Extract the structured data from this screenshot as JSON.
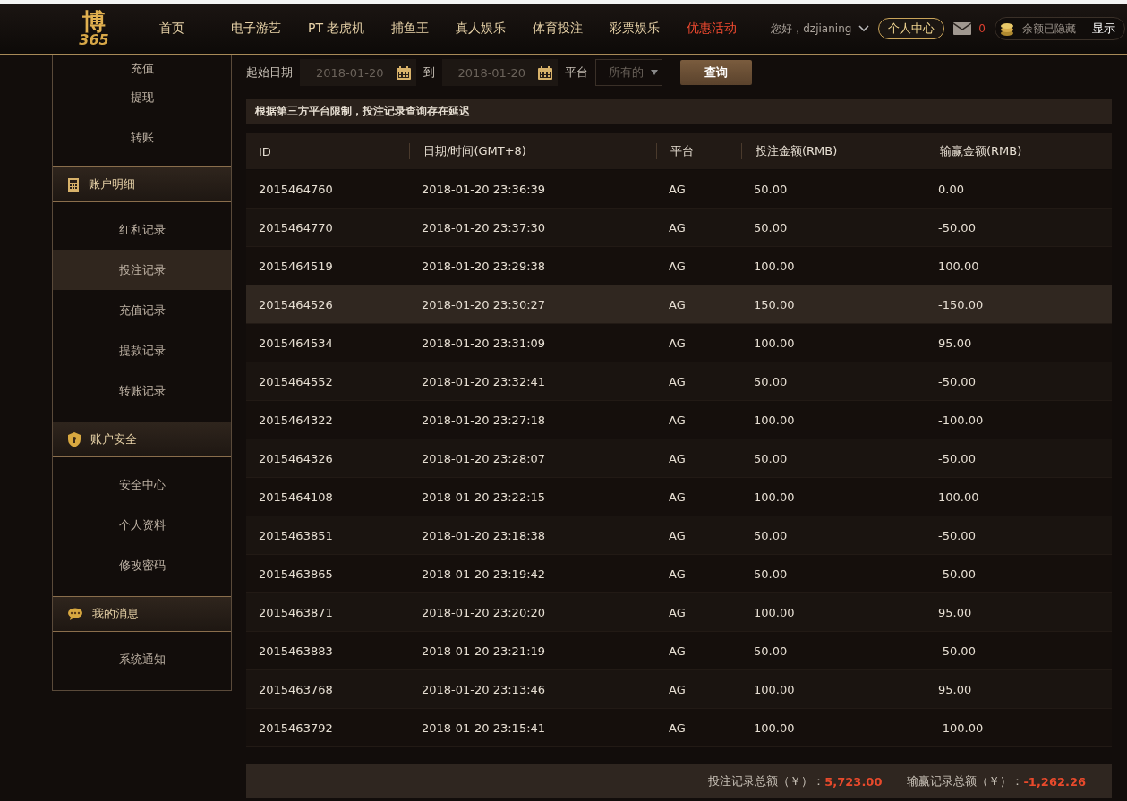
{
  "header": {
    "logo": {
      "text": "博",
      "number": "365"
    },
    "nav": [
      {
        "label": "首页",
        "highlight": false
      },
      {
        "label": "电子游艺",
        "highlight": false
      },
      {
        "label": "PT 老虎机",
        "highlight": false
      },
      {
        "label": "捕鱼王",
        "highlight": false
      },
      {
        "label": "真人娱乐",
        "highlight": false
      },
      {
        "label": "体育投注",
        "highlight": false
      },
      {
        "label": "彩票娱乐",
        "highlight": false
      },
      {
        "label": "优惠活动",
        "highlight": true
      }
    ],
    "greeting": "您好，dzjianing",
    "personal_center": "个人中心",
    "messages_count": "0",
    "balance": "余额已隐藏",
    "show_button": "显示"
  },
  "sidebar": {
    "sections": [
      {
        "items": [
          {
            "label": "充值",
            "selected": false
          },
          {
            "label": "提现",
            "selected": false
          },
          {
            "label": "转账",
            "selected": false
          }
        ]
      },
      {
        "title": "账户明细",
        "kind": "calculator",
        "items": [
          {
            "label": "红利记录",
            "selected": false
          },
          {
            "label": "投注记录",
            "selected": true
          },
          {
            "label": "充值记录",
            "selected": false
          },
          {
            "label": "提款记录",
            "selected": false
          },
          {
            "label": "转账记录",
            "selected": false
          }
        ]
      },
      {
        "title": "账户安全",
        "kind": "shield",
        "items": [
          {
            "label": "安全中心",
            "selected": false
          },
          {
            "label": "个人资料",
            "selected": false
          },
          {
            "label": "修改密码",
            "selected": false
          }
        ]
      },
      {
        "title": "我的消息",
        "kind": "chat",
        "items": [
          {
            "label": "系统通知",
            "selected": false
          }
        ]
      }
    ]
  },
  "filters": {
    "start_label": "起始日期",
    "start_date": "2018-01-20",
    "to_label": "到",
    "end_date": "2018-01-20",
    "platform_label": "平台",
    "platform_value": "所有的",
    "query_button": "查询"
  },
  "notice": "根据第三方平台限制，投注记录查询存在延迟",
  "table": {
    "columns": [
      "ID",
      "日期/时间(GMT+8)",
      "平台",
      "投注金额(RMB)",
      "输赢金额(RMB)"
    ],
    "rows": [
      {
        "cells": [
          "2015464760",
          "2018-01-20 23:36:39",
          "AG",
          "50.00",
          "0.00"
        ],
        "highlighted": false
      },
      {
        "cells": [
          "2015464770",
          "2018-01-20 23:37:30",
          "AG",
          "50.00",
          "-50.00"
        ],
        "highlighted": false
      },
      {
        "cells": [
          "2015464519",
          "2018-01-20 23:29:38",
          "AG",
          "100.00",
          "100.00"
        ],
        "highlighted": false
      },
      {
        "cells": [
          "2015464526",
          "2018-01-20 23:30:27",
          "AG",
          "150.00",
          "-150.00"
        ],
        "highlighted": true
      },
      {
        "cells": [
          "2015464534",
          "2018-01-20 23:31:09",
          "AG",
          "100.00",
          "95.00"
        ],
        "highlighted": false
      },
      {
        "cells": [
          "2015464552",
          "2018-01-20 23:32:41",
          "AG",
          "50.00",
          "-50.00"
        ],
        "highlighted": false
      },
      {
        "cells": [
          "2015464322",
          "2018-01-20 23:27:18",
          "AG",
          "100.00",
          "-100.00"
        ],
        "highlighted": false
      },
      {
        "cells": [
          "2015464326",
          "2018-01-20 23:28:07",
          "AG",
          "50.00",
          "-50.00"
        ],
        "highlighted": false
      },
      {
        "cells": [
          "2015464108",
          "2018-01-20 23:22:15",
          "AG",
          "100.00",
          "100.00"
        ],
        "highlighted": false
      },
      {
        "cells": [
          "2015463851",
          "2018-01-20 23:18:38",
          "AG",
          "50.00",
          "-50.00"
        ],
        "highlighted": false
      },
      {
        "cells": [
          "2015463865",
          "2018-01-20 23:19:42",
          "AG",
          "50.00",
          "-50.00"
        ],
        "highlighted": false
      },
      {
        "cells": [
          "2015463871",
          "2018-01-20 23:20:20",
          "AG",
          "100.00",
          "95.00"
        ],
        "highlighted": false
      },
      {
        "cells": [
          "2015463883",
          "2018-01-20 23:21:19",
          "AG",
          "50.00",
          "-50.00"
        ],
        "highlighted": false
      },
      {
        "cells": [
          "2015463768",
          "2018-01-20 23:13:46",
          "AG",
          "100.00",
          "95.00"
        ],
        "highlighted": false
      },
      {
        "cells": [
          "2015463792",
          "2018-01-20 23:15:41",
          "AG",
          "100.00",
          "-100.00"
        ],
        "highlighted": false
      }
    ]
  },
  "totals": [
    {
      "label": "投注记录总额（￥）：",
      "value": "5,723.00"
    },
    {
      "label": "输赢记录总额（￥）：",
      "value": "-1,262.26"
    }
  ]
}
